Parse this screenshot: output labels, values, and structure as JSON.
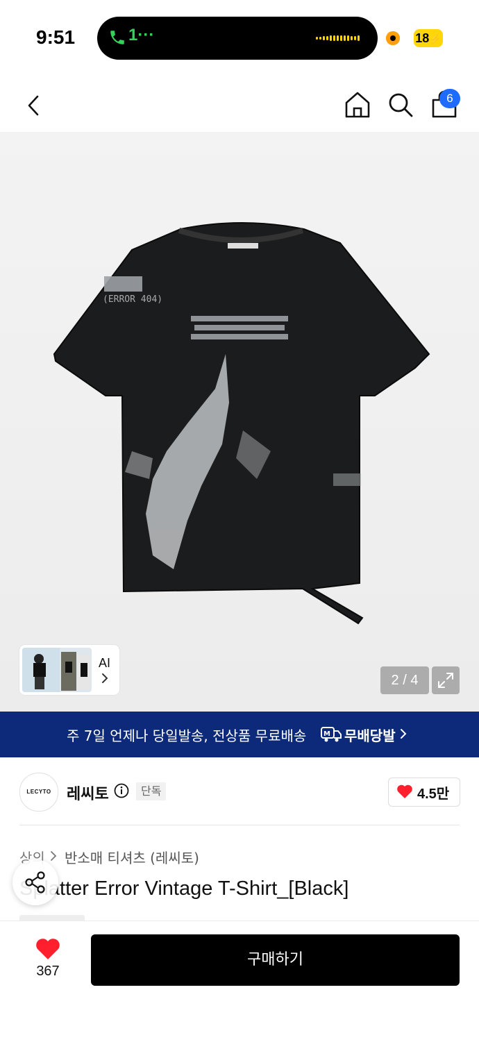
{
  "status_bar": {
    "time": "9:51",
    "call_indicator": "1···",
    "battery": "18"
  },
  "header": {
    "cart_count": "6"
  },
  "gallery": {
    "ai_label": "AI",
    "page_indicator": "2 / 4",
    "product_image": "black-distressed-tshirt"
  },
  "banner": {
    "text": "주 7일 언제나 당일발송, 전상품 무료배송",
    "brand": "무배당발",
    "background": "#0d2a7a"
  },
  "brand": {
    "logo_text": "LECYTO",
    "name": "레씨토",
    "exclusive_badge": "단독",
    "likes": "4.5만"
  },
  "product": {
    "breadcrumb": [
      "상의",
      "반소매 티셔츠 (레씨토)"
    ],
    "title": "Splatter Error Vintage T-Shirt_[Black]"
  },
  "bottom_bar": {
    "favorite_count": "367",
    "buy_label": "구매하기"
  },
  "colors": {
    "accent_heart": "#ff1f2d",
    "badge_blue": "#1d6bff",
    "buy_button": "#000000"
  }
}
